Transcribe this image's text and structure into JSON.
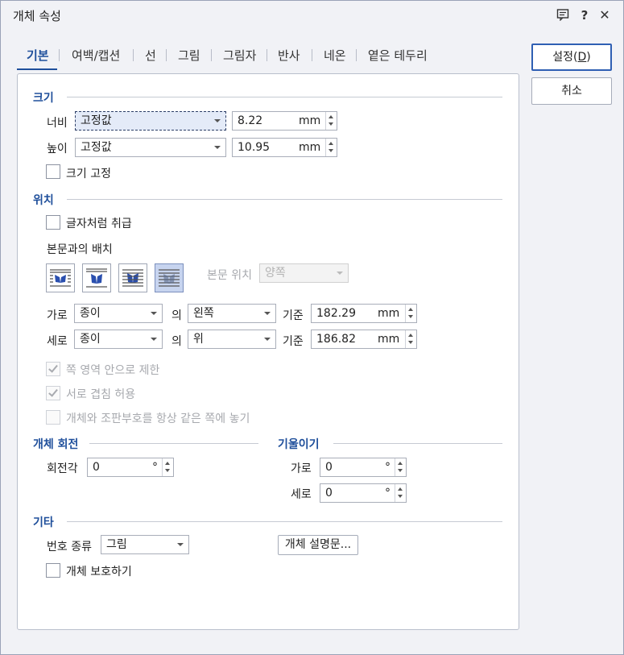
{
  "title": "개체 속성",
  "titlebar_icons": [
    "comment-icon",
    "help-icon",
    "close-icon"
  ],
  "help_glyph": "?",
  "close_glyph": "✕",
  "tabs": [
    "기본",
    "여백/캡션",
    "선",
    "그림",
    "그림자",
    "반사",
    "네온",
    "옅은 테두리"
  ],
  "buttons": {
    "ok": {
      "pre": "설정(",
      "key": "D",
      "post": ")"
    },
    "cancel": "취소"
  },
  "size": {
    "title": "크기",
    "width_label": "너비",
    "width_mode": "고정값",
    "width_value": "8.22",
    "height_label": "높이",
    "height_mode": "고정값",
    "height_value": "10.95",
    "unit": "mm",
    "fix_size": "크기 고정",
    "fix_size_checked": false
  },
  "position": {
    "title": "위치",
    "treat_as_char": "글자처럼 취급",
    "treat_as_char_checked": false,
    "wrap_label": "본문과의 배치",
    "wrap_options": [
      "wrap-square-icon",
      "wrap-top-bottom-icon",
      "wrap-behind-text-icon",
      "wrap-in-front-icon"
    ],
    "wrap_selected": 3,
    "body_pos_label": "본문 위치",
    "body_pos_value": "양쪽",
    "horiz_label": "가로",
    "horiz_ref": "종이",
    "of": "의",
    "horiz_align": "왼쪽",
    "base": "기준",
    "horiz_value": "182.29",
    "vert_label": "세로",
    "vert_ref": "종이",
    "vert_align": "위",
    "vert_value": "186.82",
    "unit": "mm",
    "restrict": "쪽 영역 안으로 제한",
    "allow_overlap": "서로 겹침 허용",
    "same_page": "개체와 조판부호를 항상 같은 쪽에 놓기"
  },
  "rotation": {
    "title": "개체 회전",
    "angle_label": "회전각",
    "angle_value": "0",
    "degree": "°"
  },
  "skew": {
    "title": "기울이기",
    "h_label": "가로",
    "h_value": "0",
    "v_label": "세로",
    "v_value": "0",
    "degree": "°"
  },
  "etc": {
    "title": "기타",
    "number_type_label": "번호 종류",
    "number_type_value": "그림",
    "desc_button": "개체 설명문...",
    "protect": "개체 보호하기",
    "protect_checked": false
  },
  "colors": {
    "accent": "#1f4f9b",
    "selected_wrap": "#c7d4ef",
    "focus_field": "#e4ebf8"
  }
}
